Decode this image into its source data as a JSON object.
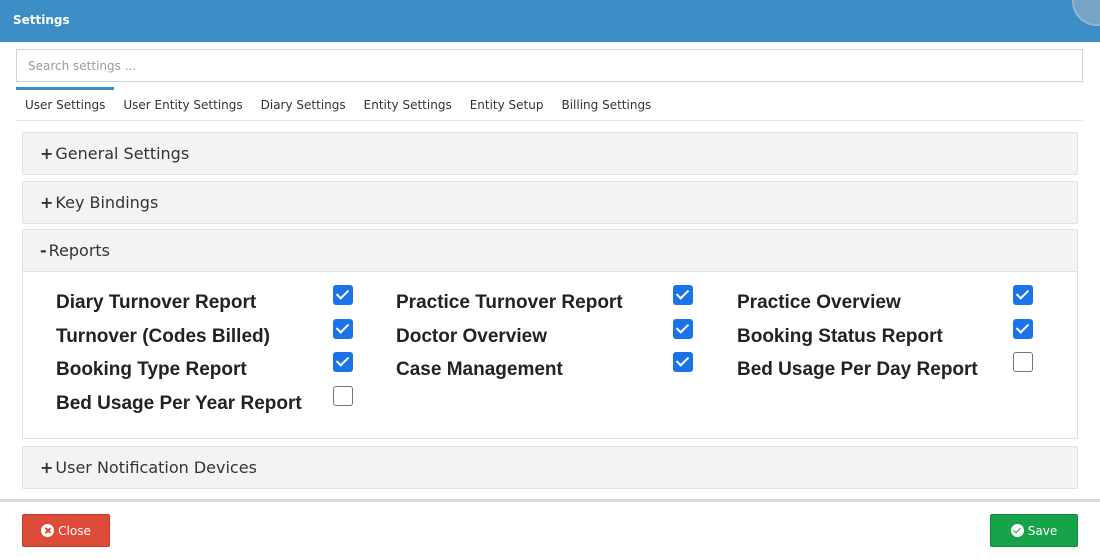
{
  "window": {
    "title": "Settings"
  },
  "search": {
    "placeholder": "Search settings ..."
  },
  "tabs": [
    {
      "label": "User Settings",
      "active": true
    },
    {
      "label": "User Entity Settings",
      "active": false
    },
    {
      "label": "Diary Settings",
      "active": false
    },
    {
      "label": "Entity Settings",
      "active": false
    },
    {
      "label": "Entity Setup",
      "active": false
    },
    {
      "label": "Billing Settings",
      "active": false
    }
  ],
  "sections": [
    {
      "sign": "+",
      "label": "General Settings",
      "expanded": false
    },
    {
      "sign": "+",
      "label": "Key Bindings",
      "expanded": false
    },
    {
      "sign": "-",
      "label": "Reports",
      "expanded": true
    },
    {
      "sign": "+",
      "label": "User Notification Devices",
      "expanded": false
    }
  ],
  "reports": {
    "items": [
      [
        {
          "label": "Diary Turnover Report",
          "checked": true
        },
        {
          "label": "Practice Turnover Report",
          "checked": true
        },
        {
          "label": "Practice Overview",
          "checked": true
        }
      ],
      [
        {
          "label": "Turnover (Codes Billed)",
          "checked": true
        },
        {
          "label": "Doctor Overview",
          "checked": true
        },
        {
          "label": "Booking Status Report",
          "checked": true
        }
      ],
      [
        {
          "label": "Booking Type Report",
          "checked": true
        },
        {
          "label": "Case Management",
          "checked": true
        },
        {
          "label": "Bed Usage Per Day Report",
          "checked": false
        }
      ],
      [
        {
          "label": "Bed Usage Per Year Report",
          "checked": false
        }
      ]
    ]
  },
  "footer": {
    "close_label": "Close",
    "save_label": "Save"
  },
  "colors": {
    "header": "#3c8dc5",
    "close": "#dd4b39",
    "save": "#16a34a",
    "checkbox": "#1a73e8"
  }
}
